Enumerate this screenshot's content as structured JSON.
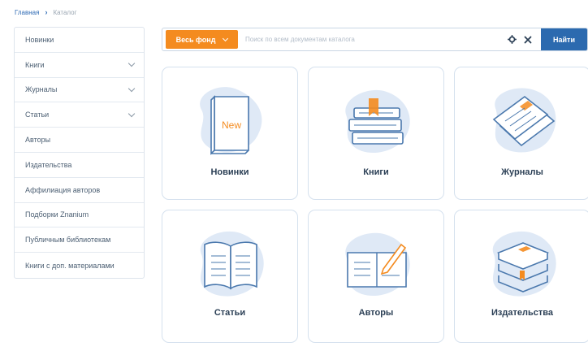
{
  "breadcrumb": {
    "home": "Главная",
    "current": "Каталог"
  },
  "sidebar": {
    "items": [
      {
        "label": "Новинки",
        "has_submenu": false
      },
      {
        "label": "Книги",
        "has_submenu": true
      },
      {
        "label": "Журналы",
        "has_submenu": true
      },
      {
        "label": "Статьи",
        "has_submenu": true
      },
      {
        "label": "Авторы",
        "has_submenu": false
      },
      {
        "label": "Издательства",
        "has_submenu": false
      },
      {
        "label": "Аффилиация авторов",
        "has_submenu": false
      },
      {
        "label": "Подборки Znanium",
        "has_submenu": false
      },
      {
        "label": "Публичным библиотекам",
        "has_submenu": false
      },
      {
        "label": "Книги с доп. материалами",
        "has_submenu": false
      }
    ]
  },
  "search": {
    "fund_label": "Весь фонд",
    "placeholder": "Поиск по всем документам каталога",
    "value": "",
    "submit_label": "Найти"
  },
  "cards": [
    {
      "label": "Новинки",
      "icon": "new-book-icon",
      "icon_text": "New"
    },
    {
      "label": "Книги",
      "icon": "books-stack-icon"
    },
    {
      "label": "Журналы",
      "icon": "magazines-icon"
    },
    {
      "label": "Статьи",
      "icon": "open-book-icon"
    },
    {
      "label": "Авторы",
      "icon": "book-pen-icon"
    },
    {
      "label": "Издательства",
      "icon": "publishing-stack-icon"
    }
  ],
  "colors": {
    "accent_orange": "#f48b1f",
    "primary_blue": "#2c6aaf",
    "icon_stroke": "#4a78ad",
    "icon_bg": "#dfe9f6"
  }
}
